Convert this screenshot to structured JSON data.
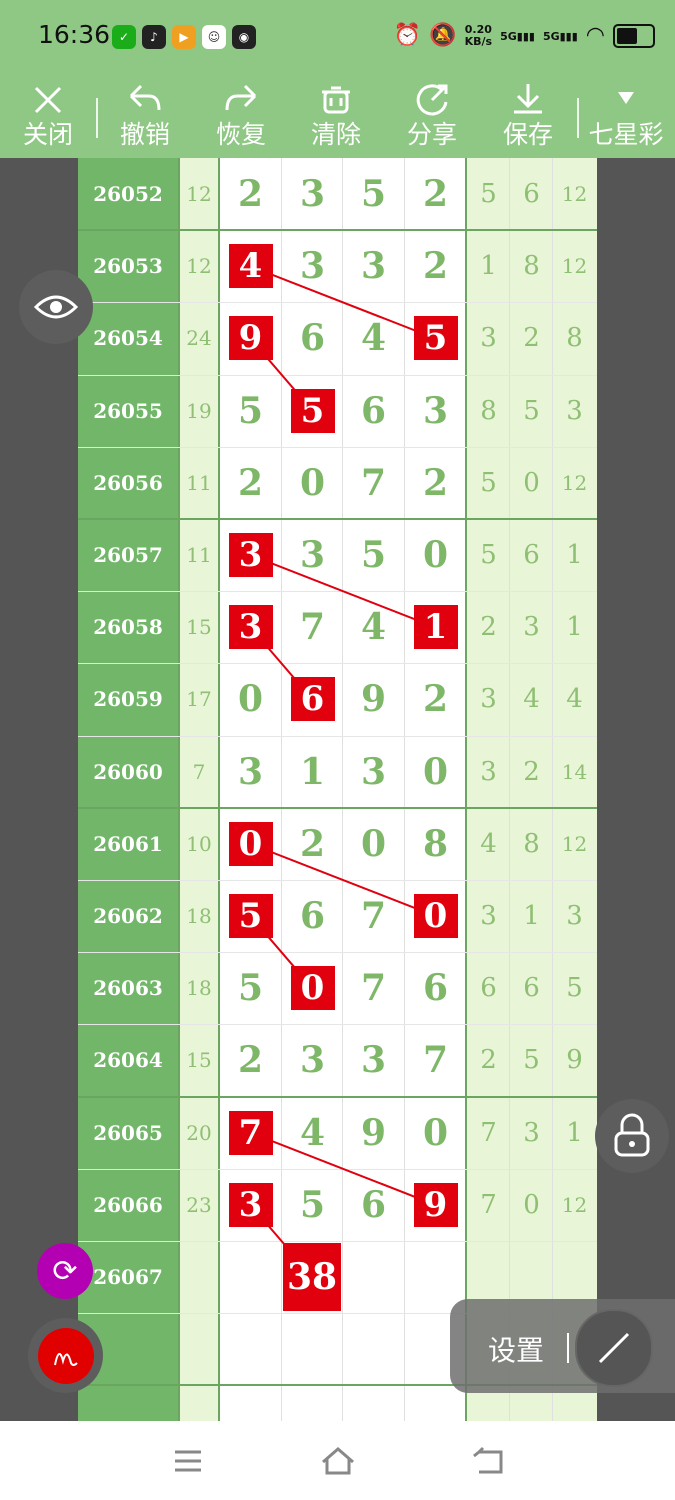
{
  "status_bar": {
    "time": "16:36",
    "app_icons": [
      "wechat-icon",
      "tiktok-icon",
      "video-app-icon",
      "avatar-app-icon",
      "camera-app-icon"
    ],
    "net_speed_value": "0.20",
    "net_speed_unit": "KB/s",
    "signal1": "5G",
    "signal2": "5G"
  },
  "toolbar": {
    "close_label": "关闭",
    "undo_label": "撤销",
    "redo_label": "恢复",
    "clear_label": "清除",
    "share_label": "分享",
    "save_label": "保存",
    "lottery_label": "七星彩"
  },
  "table": {
    "rows": [
      {
        "period": "26052",
        "sum": "12",
        "d": [
          "2",
          "3",
          "5",
          "2"
        ],
        "r": [
          "5",
          "6",
          "12"
        ]
      },
      {
        "period": "26053",
        "sum": "12",
        "d": [
          "4",
          "3",
          "3",
          "2"
        ],
        "r": [
          "1",
          "8",
          "12"
        ]
      },
      {
        "period": "26054",
        "sum": "24",
        "d": [
          "9",
          "6",
          "4",
          "5"
        ],
        "r": [
          "3",
          "2",
          "8"
        ]
      },
      {
        "period": "26055",
        "sum": "19",
        "d": [
          "5",
          "5",
          "6",
          "3"
        ],
        "r": [
          "8",
          "5",
          "3"
        ]
      },
      {
        "period": "26056",
        "sum": "11",
        "d": [
          "2",
          "0",
          "7",
          "2"
        ],
        "r": [
          "5",
          "0",
          "12"
        ]
      },
      {
        "period": "26057",
        "sum": "11",
        "d": [
          "3",
          "3",
          "5",
          "0"
        ],
        "r": [
          "5",
          "6",
          "1"
        ]
      },
      {
        "period": "26058",
        "sum": "15",
        "d": [
          "3",
          "7",
          "4",
          "1"
        ],
        "r": [
          "2",
          "3",
          "1"
        ]
      },
      {
        "period": "26059",
        "sum": "17",
        "d": [
          "0",
          "6",
          "9",
          "2"
        ],
        "r": [
          "3",
          "4",
          "4"
        ]
      },
      {
        "period": "26060",
        "sum": "7",
        "d": [
          "3",
          "1",
          "3",
          "0"
        ],
        "r": [
          "3",
          "2",
          "14"
        ]
      },
      {
        "period": "26061",
        "sum": "10",
        "d": [
          "0",
          "2",
          "0",
          "8"
        ],
        "r": [
          "4",
          "8",
          "12"
        ]
      },
      {
        "period": "26062",
        "sum": "18",
        "d": [
          "5",
          "6",
          "7",
          "0"
        ],
        "r": [
          "3",
          "1",
          "3"
        ]
      },
      {
        "period": "26063",
        "sum": "18",
        "d": [
          "5",
          "0",
          "7",
          "6"
        ],
        "r": [
          "6",
          "6",
          "5"
        ]
      },
      {
        "period": "26064",
        "sum": "15",
        "d": [
          "2",
          "3",
          "3",
          "7"
        ],
        "r": [
          "2",
          "5",
          "9"
        ]
      },
      {
        "period": "26065",
        "sum": "20",
        "d": [
          "7",
          "4",
          "9",
          "0"
        ],
        "r": [
          "7",
          "3",
          "1"
        ]
      },
      {
        "period": "26066",
        "sum": "23",
        "d": [
          "3",
          "5",
          "6",
          "9"
        ],
        "r": [
          "7",
          "0",
          "12"
        ]
      },
      {
        "period": "26067",
        "sum": "",
        "d": [
          "",
          "",
          "",
          ""
        ],
        "r": [
          "",
          "",
          ""
        ]
      },
      {
        "period": "",
        "sum": "",
        "d": [
          "",
          "",
          "",
          ""
        ],
        "r": [
          "",
          "",
          ""
        ]
      }
    ],
    "highlights": [
      {
        "row": 1,
        "col": 0
      },
      {
        "row": 2,
        "col": 0
      },
      {
        "row": 2,
        "col": 3
      },
      {
        "row": 3,
        "col": 1
      },
      {
        "row": 5,
        "col": 0
      },
      {
        "row": 6,
        "col": 0
      },
      {
        "row": 6,
        "col": 3
      },
      {
        "row": 7,
        "col": 1
      },
      {
        "row": 9,
        "col": 0
      },
      {
        "row": 10,
        "col": 0
      },
      {
        "row": 10,
        "col": 3
      },
      {
        "row": 11,
        "col": 1
      },
      {
        "row": 13,
        "col": 0
      },
      {
        "row": 14,
        "col": 0
      },
      {
        "row": 14,
        "col": 3
      }
    ],
    "prediction": "38"
  },
  "float": {
    "settings_label": "设置"
  },
  "colors": {
    "header_green": "#8fc784",
    "period_green": "#72b66a",
    "mark_red": "#e0000e"
  }
}
